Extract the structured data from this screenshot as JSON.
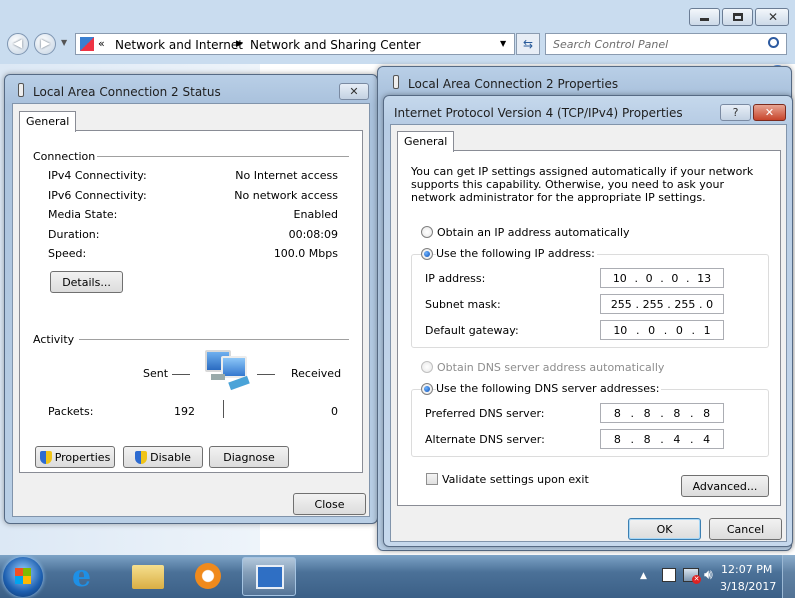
{
  "explorer": {
    "breadcrumb": [
      "Network and Internet",
      "Network and Sharing Center"
    ],
    "search_placeholder": "Search Control Panel"
  },
  "status": {
    "title": "Local Area Connection 2 Status",
    "tab": "General",
    "connection_header": "Connection",
    "rows": [
      {
        "label": "IPv4 Connectivity:",
        "value": "No Internet access"
      },
      {
        "label": "IPv6 Connectivity:",
        "value": "No network access"
      },
      {
        "label": "Media State:",
        "value": "Enabled"
      },
      {
        "label": "Duration:",
        "value": "00:08:09"
      },
      {
        "label": "Speed:",
        "value": "100.0 Mbps"
      }
    ],
    "details_button": "Details...",
    "activity_header": "Activity",
    "sent_label": "Sent",
    "received_label": "Received",
    "packets_label": "Packets:",
    "packets_sent": "192",
    "packets_received": "0",
    "properties_button": "Properties",
    "disable_button": "Disable",
    "diagnose_button": "Diagnose",
    "close_button": "Close"
  },
  "props": {
    "title": "Local Area Connection 2 Properties"
  },
  "ipv4": {
    "title": "Internet Protocol Version 4 (TCP/IPv4) Properties",
    "help_button": "?",
    "tab": "General",
    "description": "You can get IP settings assigned automatically if your network supports this capability. Otherwise, you need to ask your network administrator for the appropriate IP settings.",
    "obtain_ip_auto": "Obtain an IP address automatically",
    "use_following_ip": "Use the following IP address:",
    "ip_label": "IP address:",
    "ip_value": [
      "10",
      "0",
      "0",
      "13"
    ],
    "mask_label": "Subnet mask:",
    "mask_value": [
      "255",
      "255",
      "255",
      "0"
    ],
    "gateway_label": "Default gateway:",
    "gateway_value": [
      "10",
      "0",
      "0",
      "1"
    ],
    "obtain_dns_auto": "Obtain DNS server address automatically",
    "use_following_dns": "Use the following DNS server addresses:",
    "preferred_label": "Preferred DNS server:",
    "preferred_value": [
      "8",
      "8",
      "8",
      "8"
    ],
    "alternate_label": "Alternate DNS server:",
    "alternate_value": [
      "8",
      "8",
      "4",
      "4"
    ],
    "validate_label": "Validate settings upon exit",
    "advanced_button": "Advanced...",
    "ok_button": "OK",
    "cancel_button": "Cancel"
  },
  "taskbar": {
    "time": "12:07 PM",
    "date": "3/18/2017"
  }
}
